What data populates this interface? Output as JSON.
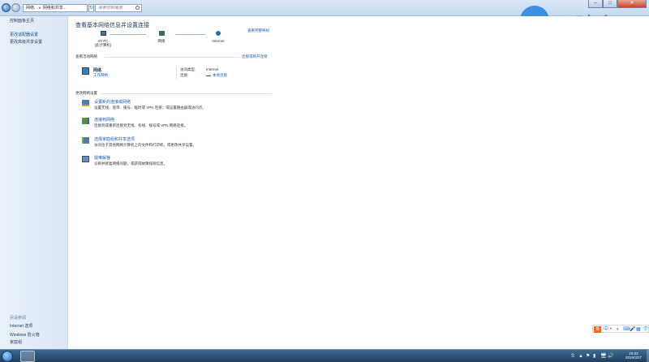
{
  "titlebar": {
    "address_parts": [
      "网络...",
      "网络和共享..."
    ],
    "search_placeholder": "搜索控制面板",
    "window_controls": {
      "minimize": "–",
      "maximize": "□",
      "close": "✕"
    }
  },
  "watermark": {
    "text": "云骑士"
  },
  "left_pane": {
    "home": "控制面板主页",
    "adapter_settings": "更改适配器设置",
    "sharing_settings": "更改高级共享设置",
    "see_also": "另请参阅",
    "internet_options": "Internet 选项",
    "firewall": "Windows 防火墙",
    "homegroup": "家庭组"
  },
  "main": {
    "title": "查看基本网络信息并设置连接",
    "full_map": "查看完整映射",
    "map": {
      "pc_name": "XT-PC",
      "pc_sub": "(此计算机)",
      "network": "网络",
      "internet": "Internet"
    },
    "active_section": "查看活动网络",
    "connect_link": "连接或断开连接",
    "active_network": {
      "name": "网络",
      "type": "工作网络",
      "access_label": "访问类型:",
      "access_value": "Internet",
      "conn_label": "连接:",
      "conn_value": "本地连接"
    },
    "change_section": "更改网络设置",
    "tasks": [
      {
        "link": "设置新的连接或网络",
        "desc": "设置无线、宽带、拨号、临时或 VPN 连接；或设置路由器或访问点。"
      },
      {
        "link": "连接到网络",
        "desc": "连接到或重新连接到无线、有线、拨号或 VPN 网络连接。"
      },
      {
        "link": "选择家庭组和共享选项",
        "desc": "访问位于其他网络计算机上的文件和打印机，或更改共享设置。"
      },
      {
        "link": "疑难解答",
        "desc": "诊断并修复网络问题，或获得故障排除信息。"
      }
    ]
  },
  "ime": {
    "logo": "S",
    "glyphs": [
      "中",
      "•",
      "◐",
      "⌨",
      "🎤",
      "▦",
      "👕"
    ]
  },
  "tray": {
    "icons": [
      "S",
      "▲",
      "⚑",
      "▮",
      "🖥",
      "🔊"
    ],
    "time": "15:03",
    "date": "2019/3/27"
  }
}
